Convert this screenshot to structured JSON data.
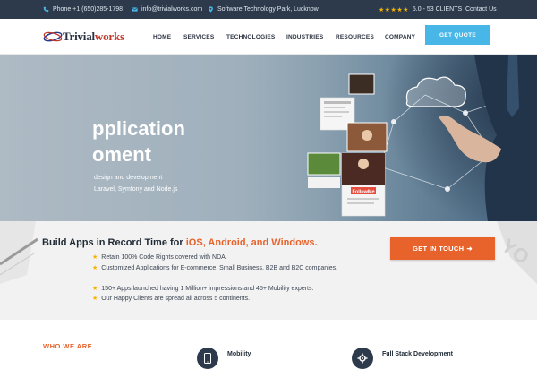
{
  "topbar": {
    "phone": "Phone +1 (650)285-1798",
    "email": "info@trivialworks.com",
    "location": "Software Technology Park, Lucknow",
    "stars": "★★★★★",
    "rating": "5.0 - 53 CLIENTS",
    "contact": "Contact Us"
  },
  "logo": {
    "part1": "Trivial",
    "part2": "works"
  },
  "nav": {
    "items": [
      "HOME",
      "SERVICES",
      "TECHNOLOGIES",
      "INDUSTRIES",
      "RESOURCES",
      "COMPANY"
    ],
    "quote": "GET QUOTE"
  },
  "hero": {
    "title_line1": "pplication",
    "title_line2": "oment",
    "sub_line1": "design and development",
    "sub_line2": "Laravel, Symfony and Node.js",
    "app_name": "FollowMe"
  },
  "build": {
    "title_prefix": "Build Apps in Record Time for ",
    "title_highlight": "iOS, Android, and Windows.",
    "bullets": [
      "Retain 100% Code Rights covered with NDA.",
      "Customized Applications for E-commerce, Small Business, B2B and B2C companies.",
      "150+ Apps launched having 1 Million+ impressions and 45+ Mobility experts.",
      "Our Happy Clients are spread all across 5 continents."
    ],
    "cta": "GET IN TOUCH",
    "cta_arrow": "➜"
  },
  "bottom": {
    "who": "WHO WE ARE",
    "service1": "Mobility",
    "service2": "Full Stack Development"
  },
  "colors": {
    "accent": "#e8632c",
    "blue": "#48b6e6",
    "dark": "#2c3a4b",
    "star": "#f4b400"
  }
}
